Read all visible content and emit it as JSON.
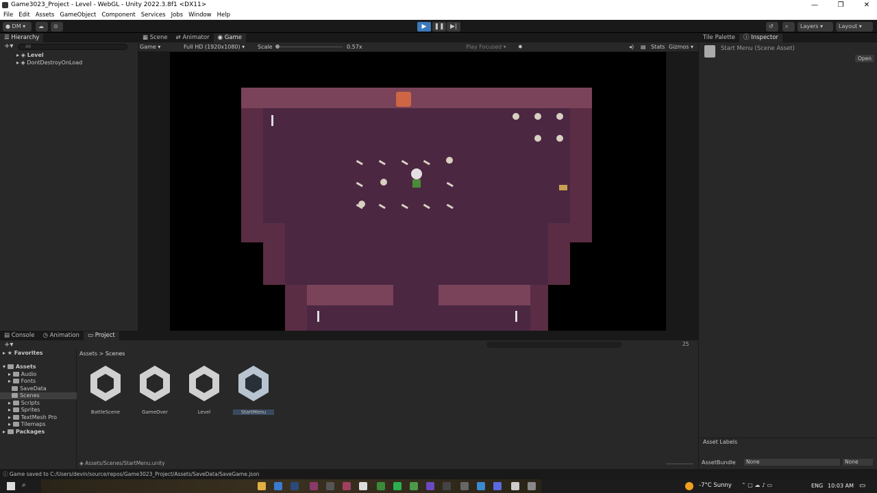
{
  "window": {
    "title": "Game3023_Project - Level - WebGL - Unity 2022.3.8f1 <DX11>",
    "controls": [
      "—",
      "❐",
      "✕"
    ]
  },
  "menu": [
    "File",
    "Edit",
    "Assets",
    "GameObject",
    "Component",
    "Services",
    "Jobs",
    "Window",
    "Help"
  ],
  "toolbar": {
    "account": "DM",
    "layers": "Layers",
    "layout": "Layout"
  },
  "hierarchy": {
    "tab": "Hierarchy",
    "search_placeholder": "All",
    "items": [
      "Level",
      "DontDestroyOnLoad"
    ]
  },
  "center_tabs": [
    "Scene",
    "Animator",
    "Game"
  ],
  "game_bar": {
    "display": "Game",
    "resolution": "Full HD (1920x1080)",
    "scale_label": "Scale",
    "scale_value": "0.57x",
    "play_focused": "Play Focused",
    "stats": "Stats",
    "gizmos": "Gizmos"
  },
  "right_tabs": [
    "Tile Palette",
    "Inspector"
  ],
  "inspector": {
    "asset_title": "Start Menu (Scene Asset)",
    "open_button": "Open",
    "asset_labels": "Asset Labels",
    "asset_bundle_label": "AssetBundle",
    "asset_bundle_value": "None",
    "asset_variant_value": "None"
  },
  "bottom_tabs": [
    "Console",
    "Animation",
    "Project"
  ],
  "project": {
    "favorites": "Favorites",
    "assets_root": "Assets",
    "folders": [
      "Audio",
      "Fonts",
      "SaveData",
      "Scenes",
      "Scripts",
      "Sprites",
      "TextMesh Pro",
      "Tilemaps"
    ],
    "packages": "Packages",
    "breadcrumb": [
      "Assets",
      "Scenes"
    ],
    "assets": [
      "BattleScene",
      "GameOver",
      "Level",
      "StartMenu"
    ],
    "selected_path": "Assets/Scenes/StartMenu.unity",
    "count_badge": "25"
  },
  "status": {
    "message": "Game saved to C:/Users/devin/source/repos/Game3023_Project/Assets/SaveData/SaveGame.json"
  },
  "taskbar": {
    "temperature": "-7°C",
    "weather": "Sunny",
    "language": "ENG",
    "time": "10:03 AM"
  },
  "colors": {
    "accent_blue": "#4a90d9",
    "play_active": "#3a79bb",
    "dungeon_wall": "#6e3a52",
    "dungeon_floor": "#4b2742"
  }
}
